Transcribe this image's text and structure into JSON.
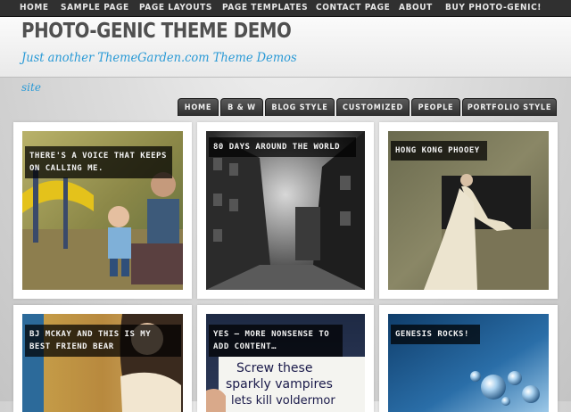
{
  "top_nav": [
    "HOME",
    "SAMPLE PAGE",
    "PAGE LAYOUTS",
    "PAGE TEMPLATES",
    "CONTACT PAGE",
    "ABOUT",
    "BUY PHOTO-GENIC!"
  ],
  "header": {
    "site_title": "PHOTO-GENIC THEME DEMO",
    "tagline": "Just another ThemeGarden.com Theme Demos",
    "site_label": "site"
  },
  "sub_nav": [
    "HOME",
    "B & W",
    "BLOG STYLE",
    "CUSTOMIZED",
    "PEOPLE",
    "PORTFOLIO STYLE"
  ],
  "posts": [
    {
      "caption": "THERE'S A VOICE THAT KEEPS ON CALLING ME."
    },
    {
      "caption": "80 DAYS AROUND THE WORLD"
    },
    {
      "caption": "HONG KONG PHOOEY"
    },
    {
      "caption": "BJ MCKAY AND THIS IS MY BEST FRIEND BEAR"
    },
    {
      "caption": "YES — MORE NONSENSE TO ADD CONTENT…"
    },
    {
      "caption": "GENESIS ROCKS!"
    }
  ],
  "photo_text": {
    "sign_line1": "Screw these",
    "sign_line2": "sparkly vampires",
    "sign_line3": "lets kill voldermor"
  },
  "colors": {
    "top_nav_bg": "#303030",
    "sub_nav_tab_bg": "#3a3a3a",
    "tagline": "#2a9ad6",
    "title": "#505050",
    "caption_bg": "rgba(0,0,0,0.72)"
  }
}
